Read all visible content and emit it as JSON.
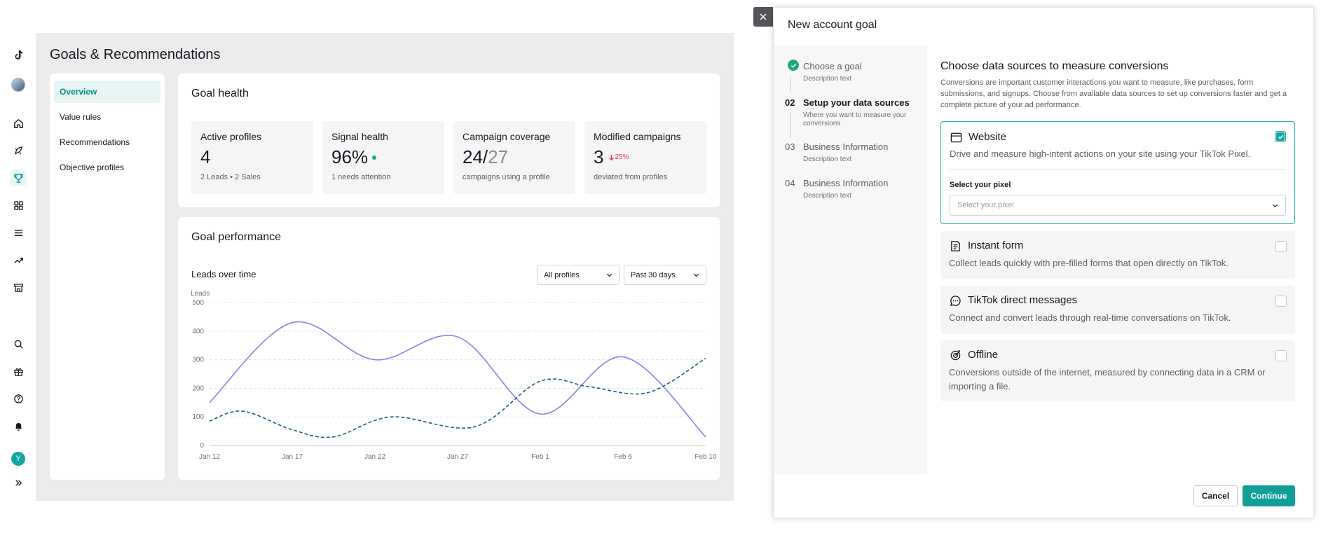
{
  "rail": {
    "icons": [
      "tiktok-logo-icon",
      "avatar",
      "home-icon",
      "rocket-icon",
      "trophy-icon",
      "grid-icon",
      "list-icon",
      "trend-icon",
      "store-icon",
      "search-icon",
      "gift-icon",
      "help-icon",
      "bell-icon",
      "user-avatar",
      "expand-icon"
    ],
    "avatar_letter": "Y"
  },
  "page": {
    "title": "Goals & Recommendations"
  },
  "subnav": {
    "items": [
      {
        "label": "Overview",
        "active": true
      },
      {
        "label": "Value rules"
      },
      {
        "label": "Recommendations"
      },
      {
        "label": "Objective profiles"
      }
    ]
  },
  "goal_health": {
    "title": "Goal health",
    "metrics": [
      {
        "title": "Active profiles",
        "value": "4",
        "sub": "2 Leads • 2 Sales"
      },
      {
        "title": "Signal health",
        "value": "96%",
        "sub": "1 needs attention"
      },
      {
        "title": "Campaign coverage",
        "value": "24/",
        "value_dim": "27",
        "sub": "campaigns using a profile"
      },
      {
        "title": "Modified campaigns",
        "value": "3",
        "delta": "25%",
        "sub": "deviated from profiles"
      }
    ]
  },
  "goal_performance": {
    "title": "Goal performance",
    "chart_title": "Leads over time",
    "filter_profiles": "All profiles",
    "filter_range": "Past 30 days"
  },
  "chart_data": {
    "type": "line",
    "ylabel": "Leads",
    "ylim": [
      0,
      500
    ],
    "yticks": [
      0,
      100,
      200,
      300,
      400,
      500
    ],
    "x_labels": [
      "Jan 12",
      "Jan 17",
      "Jan 22",
      "Jan 27",
      "Feb 1",
      "Feb 6",
      "Feb 10"
    ],
    "grid": true,
    "series": [
      {
        "style": "solid",
        "color": "#8a7ff0",
        "points": [
          [
            0,
            150
          ],
          [
            1,
            430
          ],
          [
            2,
            300
          ],
          [
            3,
            380
          ],
          [
            4,
            110
          ],
          [
            5,
            310
          ],
          [
            6,
            30
          ]
        ]
      },
      {
        "style": "dashed",
        "color": "#1f5f7a",
        "points": [
          [
            0,
            85
          ],
          [
            0.4,
            120
          ],
          [
            1,
            55
          ],
          [
            1.5,
            30
          ],
          [
            2.2,
            100
          ],
          [
            3.2,
            65
          ],
          [
            4.0,
            225
          ],
          [
            4.6,
            205
          ],
          [
            5.3,
            185
          ],
          [
            6,
            305
          ]
        ]
      }
    ]
  },
  "drawer": {
    "title": "New account goal",
    "steps": [
      {
        "num": "",
        "title": "Choose a goal",
        "desc": "Description text",
        "done": true
      },
      {
        "num": "02",
        "title": "Setup your data sources",
        "desc": "Where you want to measure your conversions",
        "current": true
      },
      {
        "num": "03",
        "title": "Business Information",
        "desc": "Description text"
      },
      {
        "num": "04",
        "title": "Business Information",
        "desc": "Description text"
      }
    ],
    "content_title": "Choose data sources to measure conversions",
    "content_desc": "Conversions are important customer interactions you want to measure, like purchases, form submissions, and signups. Choose from available data sources to set up conversions faster and get a complete picture of your ad performance.",
    "sources": [
      {
        "title": "Website",
        "desc": "Drive and measure high-intent actions on your site using your TikTok Pixel.",
        "checked": true,
        "icon": "browser-icon"
      },
      {
        "title": "Instant form",
        "desc": "Collect leads quickly with pre-filled forms that open directly on TikTok.",
        "checked": false,
        "icon": "form-icon"
      },
      {
        "title": "TikTok direct messages",
        "desc": "Connect and convert leads through real-time conversations on TikTok.",
        "checked": false,
        "icon": "chat-icon"
      },
      {
        "title": "Offline",
        "desc": "Conversions outside of the internet, measured by connecting data in a CRM or importing a file.",
        "checked": false,
        "icon": "target-icon"
      }
    ],
    "pixel_label": "Select your pixel",
    "pixel_placeholder": "Select your pixel",
    "cancel": "Cancel",
    "continue": "Continue"
  }
}
